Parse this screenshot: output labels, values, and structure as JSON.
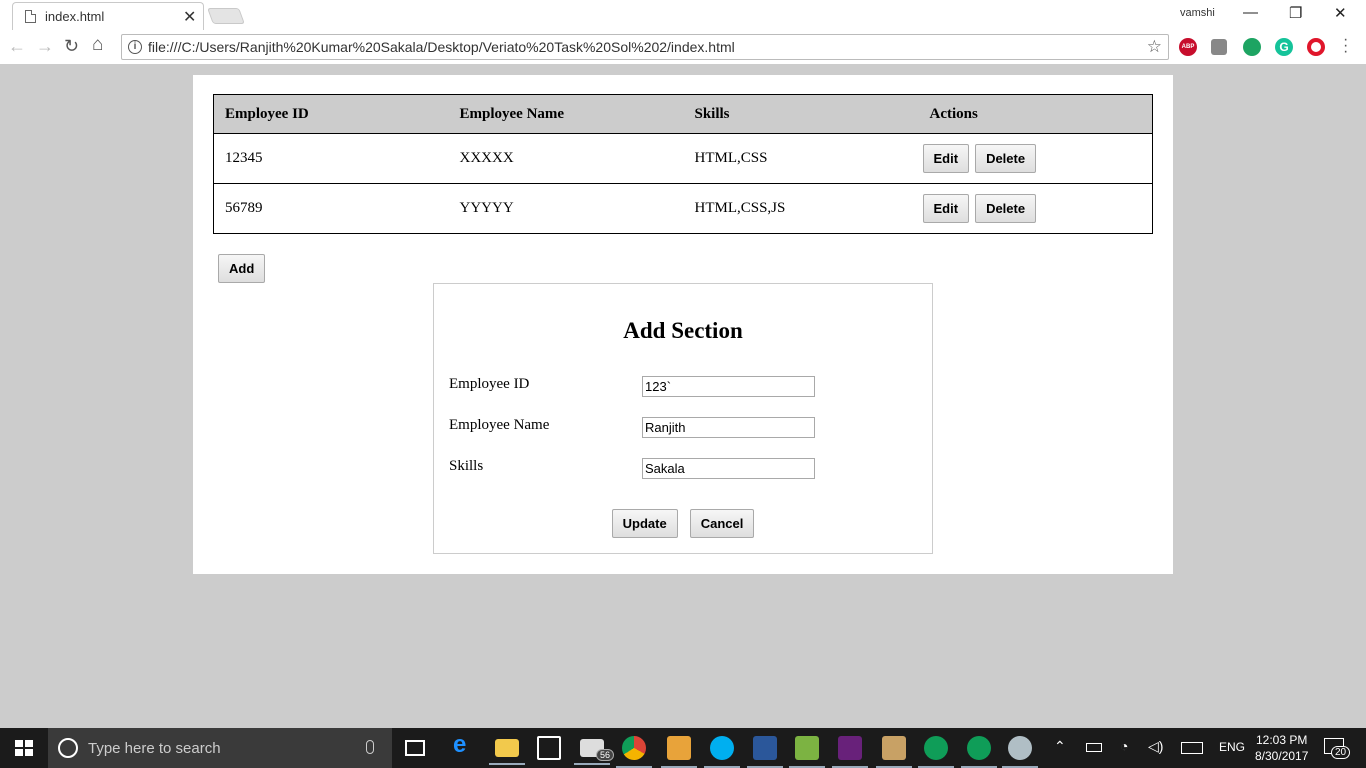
{
  "browser": {
    "tab_title": "index.html",
    "profile_name": "vamshi",
    "url": "file:///C:/Users/Ranjith%20Kumar%20Sakala/Desktop/Veriato%20Task%20Sol%202/index.html",
    "extensions": [
      "adblock-plus-icon",
      "pocket-icon",
      "hangouts-icon",
      "grammarly-icon",
      "opera-icon"
    ],
    "abp_label": "ABP",
    "grammarly_label": "G"
  },
  "table": {
    "headers": [
      "Employee ID",
      "Employee Name",
      "Skills",
      "Actions"
    ],
    "rows": [
      {
        "id": "12345",
        "name": "XXXXX",
        "skills": "HTML,CSS"
      },
      {
        "id": "56789",
        "name": "YYYYY",
        "skills": "HTML,CSS,JS"
      }
    ],
    "edit_label": "Edit",
    "delete_label": "Delete"
  },
  "add_button_label": "Add",
  "add_section": {
    "title": "Add Section",
    "fields": [
      {
        "label": "Employee ID",
        "value": "123`"
      },
      {
        "label": "Employee Name",
        "value": "Ranjith"
      },
      {
        "label": "Skills",
        "value": "Sakala"
      }
    ],
    "update_label": "Update",
    "cancel_label": "Cancel"
  },
  "taskbar": {
    "search_placeholder": "Type here to search",
    "mail_badge": "56",
    "language": "ENG",
    "time": "12:03 PM",
    "date": "8/30/2017",
    "notification_count": "20"
  },
  "colors": {
    "page_background": "#cccccc",
    "table_header": "#cccccc",
    "taskbar": "#1b1b1b"
  }
}
